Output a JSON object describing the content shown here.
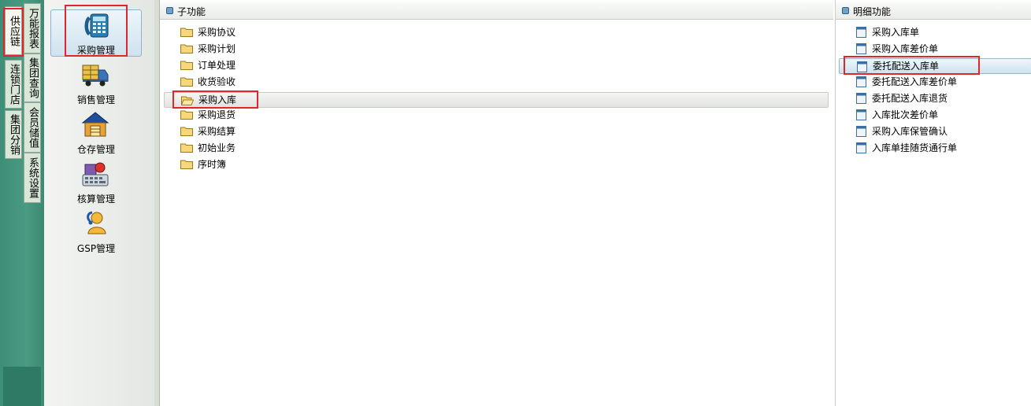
{
  "side_tabs": {
    "supply_chain": "供应链",
    "chain_store": "连锁门店",
    "group_dist": "集团分销",
    "report": "万能报表",
    "group_query": "集团查询",
    "member": "会员储值",
    "system": "系统设置"
  },
  "modules": [
    {
      "label": "采购管理",
      "icon": "phone-calculator-icon",
      "active": true
    },
    {
      "label": "销售管理",
      "icon": "delivery-truck-icon",
      "active": false
    },
    {
      "label": "仓存管理",
      "icon": "warehouse-icon",
      "active": false
    },
    {
      "label": "核算管理",
      "icon": "accounting-keyboard-icon",
      "active": false
    },
    {
      "label": "GSP管理",
      "icon": "gsp-person-icon",
      "active": false
    }
  ],
  "sub_panel": {
    "title": "子功能",
    "items": [
      {
        "label": "采购协议"
      },
      {
        "label": "采购计划"
      },
      {
        "label": "订单处理"
      },
      {
        "label": "收货验收"
      },
      {
        "label": "采购入库",
        "selected": true
      },
      {
        "label": "采购退货"
      },
      {
        "label": "采购结算"
      },
      {
        "label": "初始业务"
      },
      {
        "label": "序时簿"
      }
    ]
  },
  "detail_panel": {
    "title": "明细功能",
    "items": [
      {
        "label": "采购入库单"
      },
      {
        "label": "采购入库差价单"
      },
      {
        "label": "委托配送入库单",
        "selected": true
      },
      {
        "label": "委托配送入库差价单"
      },
      {
        "label": "委托配送入库退货"
      },
      {
        "label": "入库批次差价单"
      },
      {
        "label": "采购入库保管确认"
      },
      {
        "label": "入库单挂随货通行单"
      }
    ]
  },
  "colors": {
    "highlight_red": "#e0252b",
    "sidebar_green": "#4a9a82",
    "header_dot": "#6fa1c9"
  }
}
